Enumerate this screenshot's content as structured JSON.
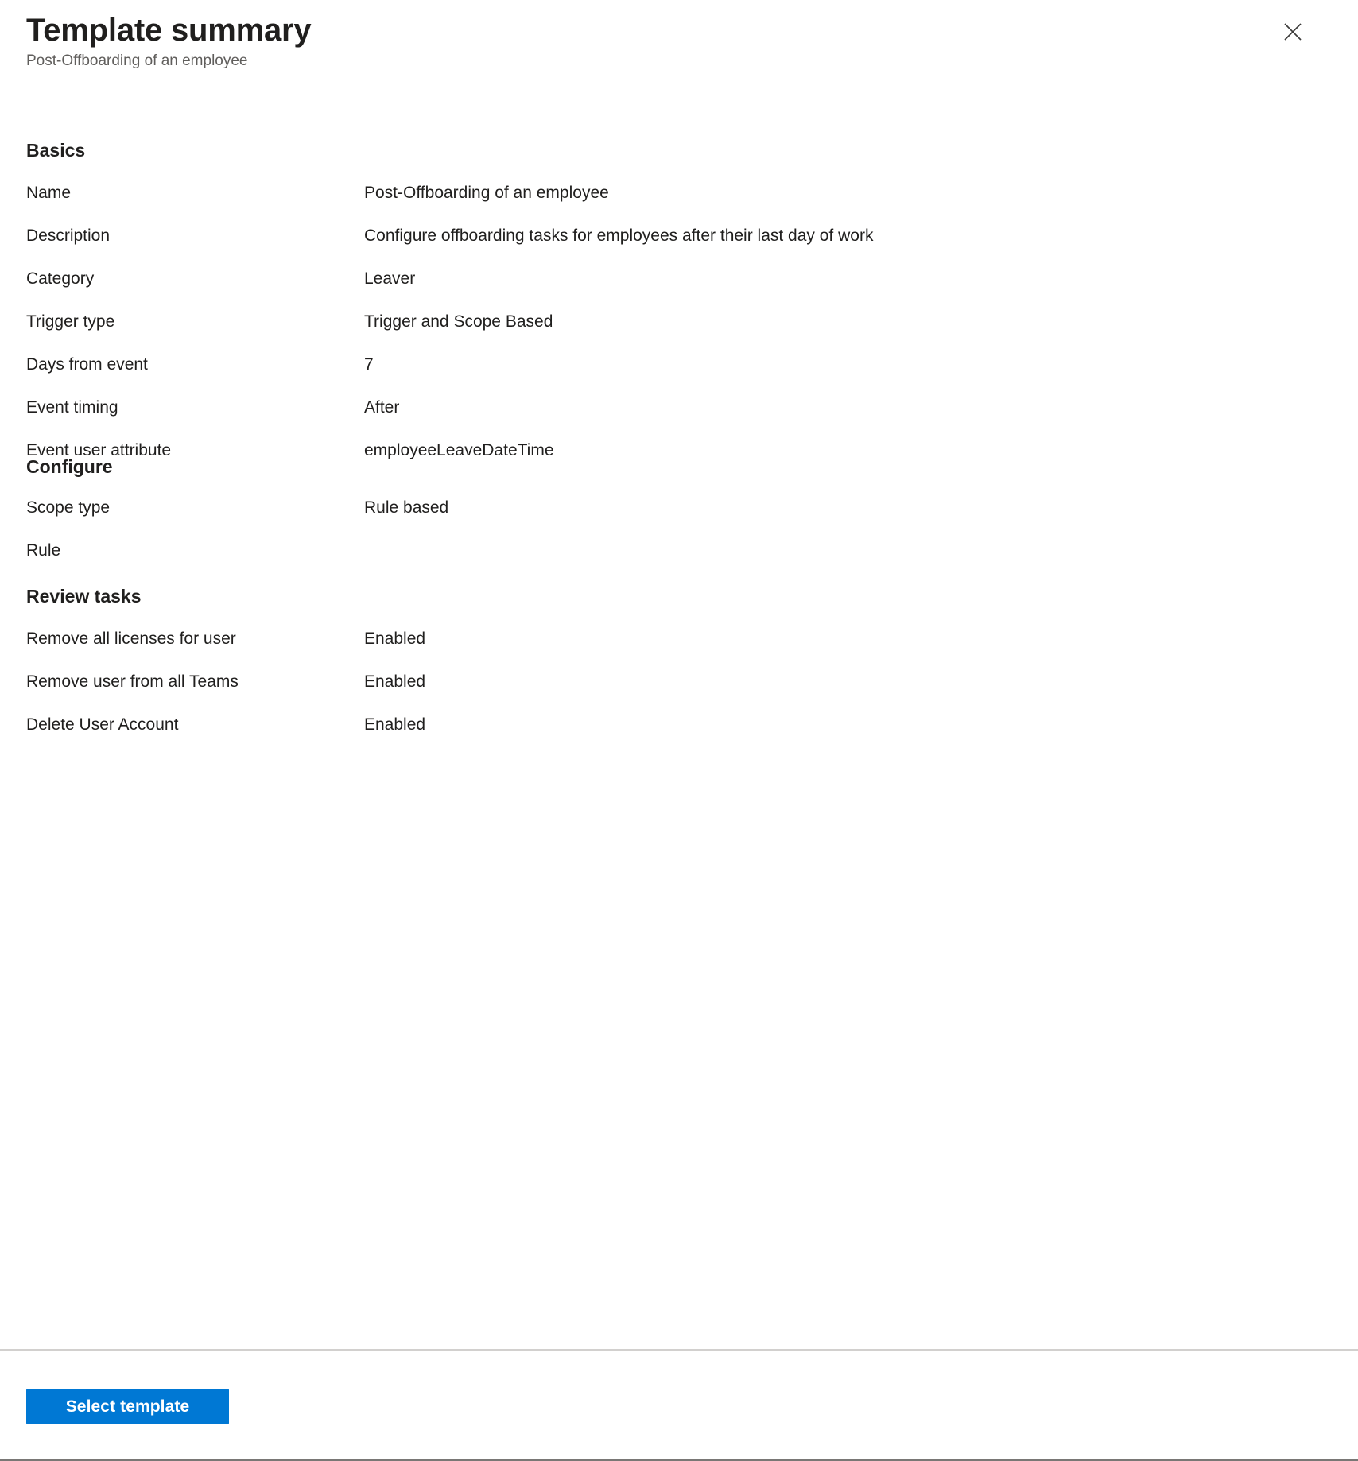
{
  "header": {
    "title": "Template summary",
    "subtitle": "Post-Offboarding of an employee",
    "close_icon": "close-icon"
  },
  "colors": {
    "primary_button": "#0078d4",
    "text": "#201f1e",
    "subtle_text": "#605e5c",
    "footer_border_top": "#d2d0ce",
    "footer_border_bottom": "#797775"
  },
  "sections": [
    {
      "id": "basics",
      "heading": "Basics",
      "rows": [
        {
          "label": "Name",
          "value": "Post-Offboarding of an employee"
        },
        {
          "label": "Description",
          "value": "Configure offboarding tasks for employees after their last day of work"
        },
        {
          "label": "Category",
          "value": "Leaver"
        },
        {
          "label": "Trigger type",
          "value": "Trigger and Scope Based"
        },
        {
          "label": "Days from event",
          "value": "7"
        },
        {
          "label": "Event timing",
          "value": "After"
        },
        {
          "label": "Event user attribute",
          "value": "employeeLeaveDateTime"
        }
      ]
    },
    {
      "id": "configure",
      "heading": "Configure",
      "rows": [
        {
          "label": "Scope type",
          "value": "Rule based"
        },
        {
          "label": "Rule",
          "value": ""
        }
      ]
    },
    {
      "id": "review",
      "heading": "Review tasks",
      "rows": [
        {
          "label": "Remove all licenses for user",
          "value": "Enabled"
        },
        {
          "label": "Remove user from all Teams",
          "value": "Enabled"
        },
        {
          "label": "Delete User Account",
          "value": "Enabled"
        }
      ]
    }
  ],
  "footer": {
    "select_template_label": "Select template"
  }
}
